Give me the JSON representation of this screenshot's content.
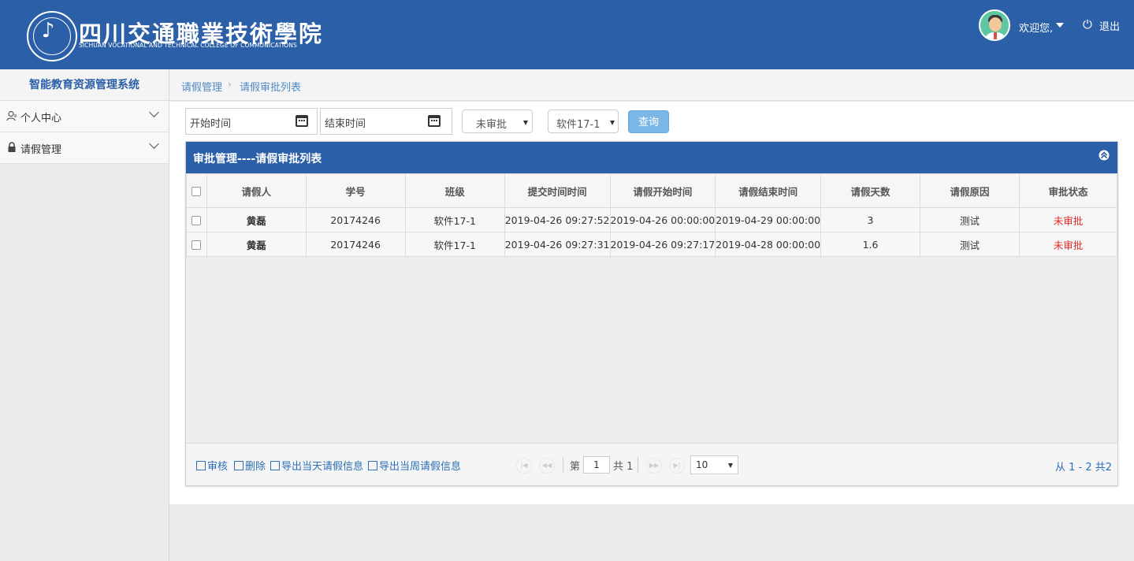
{
  "header": {
    "school_name_cn": "四川交通職業技術學院",
    "school_name_en": "SICHUAN VOCATIONAL AND TECHNICAL COLLEGE OF COMMUNICATIONS",
    "welcome": "欢迎您,",
    "logout": "退出"
  },
  "sidebar": {
    "title": "智能教育资源管理系统",
    "items": [
      {
        "label": "个人中心",
        "icon": "user-icon"
      },
      {
        "label": "请假管理",
        "icon": "lock-icon"
      }
    ]
  },
  "breadcrumb": {
    "items": [
      "请假管理",
      "请假审批列表"
    ]
  },
  "filters": {
    "start_placeholder": "开始时间",
    "end_placeholder": "结束时间",
    "status_value": "未审批",
    "class_value": "软件17-1",
    "query_label": "查询"
  },
  "panel": {
    "title": "审批管理----请假审批列表"
  },
  "table": {
    "columns": [
      "请假人",
      "学号",
      "班级",
      "提交时间时间",
      "请假开始时间",
      "请假结束时间",
      "请假天数",
      "请假原因",
      "审批状态"
    ],
    "rows": [
      [
        "黄磊",
        "20174246",
        "软件17-1",
        "2019-04-26 09:27:52",
        "2019-04-26 00:00:00",
        "2019-04-29 00:00:00",
        "3",
        "测试",
        "未审批"
      ],
      [
        "黄磊",
        "20174246",
        "软件17-1",
        "2019-04-26 09:27:31",
        "2019-04-26 09:27:17",
        "2019-04-28 00:00:00",
        "1.6",
        "测试",
        "未审批"
      ]
    ]
  },
  "footer": {
    "actions": [
      "审核",
      "删除",
      "导出当天请假信息",
      "导出当周请假信息"
    ],
    "page_prefix": "第",
    "page_value": "1",
    "page_total": "共 1",
    "page_size": "10",
    "range_text": "从 1 - 2 共2"
  },
  "colors": {
    "brand_blue": "#2b5fa8",
    "status_red": "#e02a2a",
    "link_blue": "#2b70b8"
  }
}
